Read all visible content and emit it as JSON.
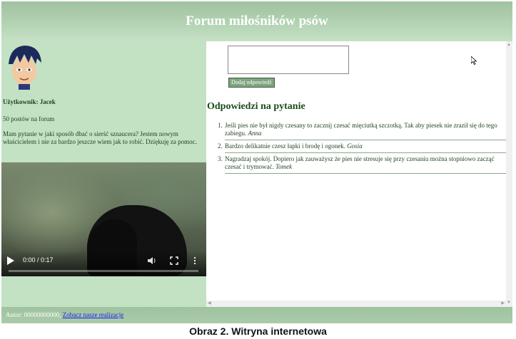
{
  "header": {
    "title": "Forum miłośników psów"
  },
  "user": {
    "name": "Użytkownik: Jacek",
    "posts": "50 postów na forum",
    "question": "Mam pytanie w jaki sposób dbać o sierść sznaucera? Jestem nowym właścicielem i nie za bardzo jeszcze wiem jak to robić. Dziękuję za pomoc."
  },
  "video": {
    "time": "0:00 / 0:17",
    "progress": 0.0
  },
  "form": {
    "textarea_value": "",
    "submit_label": "Dodaj odpowiedź"
  },
  "answers": {
    "title": "Odpowiedzi na pytanie",
    "items": [
      {
        "num": "1.",
        "text": "Jeśli pies nie był nigdy czesany to zacznij czesać mięciutką szczotką. Tak aby piesek nie zraził się do tego zabiegu.",
        "author": "Anna"
      },
      {
        "num": "2.",
        "text": "Bardzo delikatnie czesz łapki i brodę i ogonek.",
        "author": "Gosia"
      },
      {
        "num": "3.",
        "text": "Nagradzaj spokój. Dopiero jak zauważysz że pies nie stresuje się przy czesaniu można stopniowo zacząć czesać i trymować.",
        "author": "Tomek"
      }
    ]
  },
  "footer": {
    "label": "Autor: 00000000000,",
    "link": "Zobacz nasze realizacje"
  },
  "caption": "Obraz 2. Witryna internetowa",
  "colors": {
    "header": "#9fc29f",
    "left_panel": "#c3e1c3",
    "title_green": "#1a4d1a"
  }
}
